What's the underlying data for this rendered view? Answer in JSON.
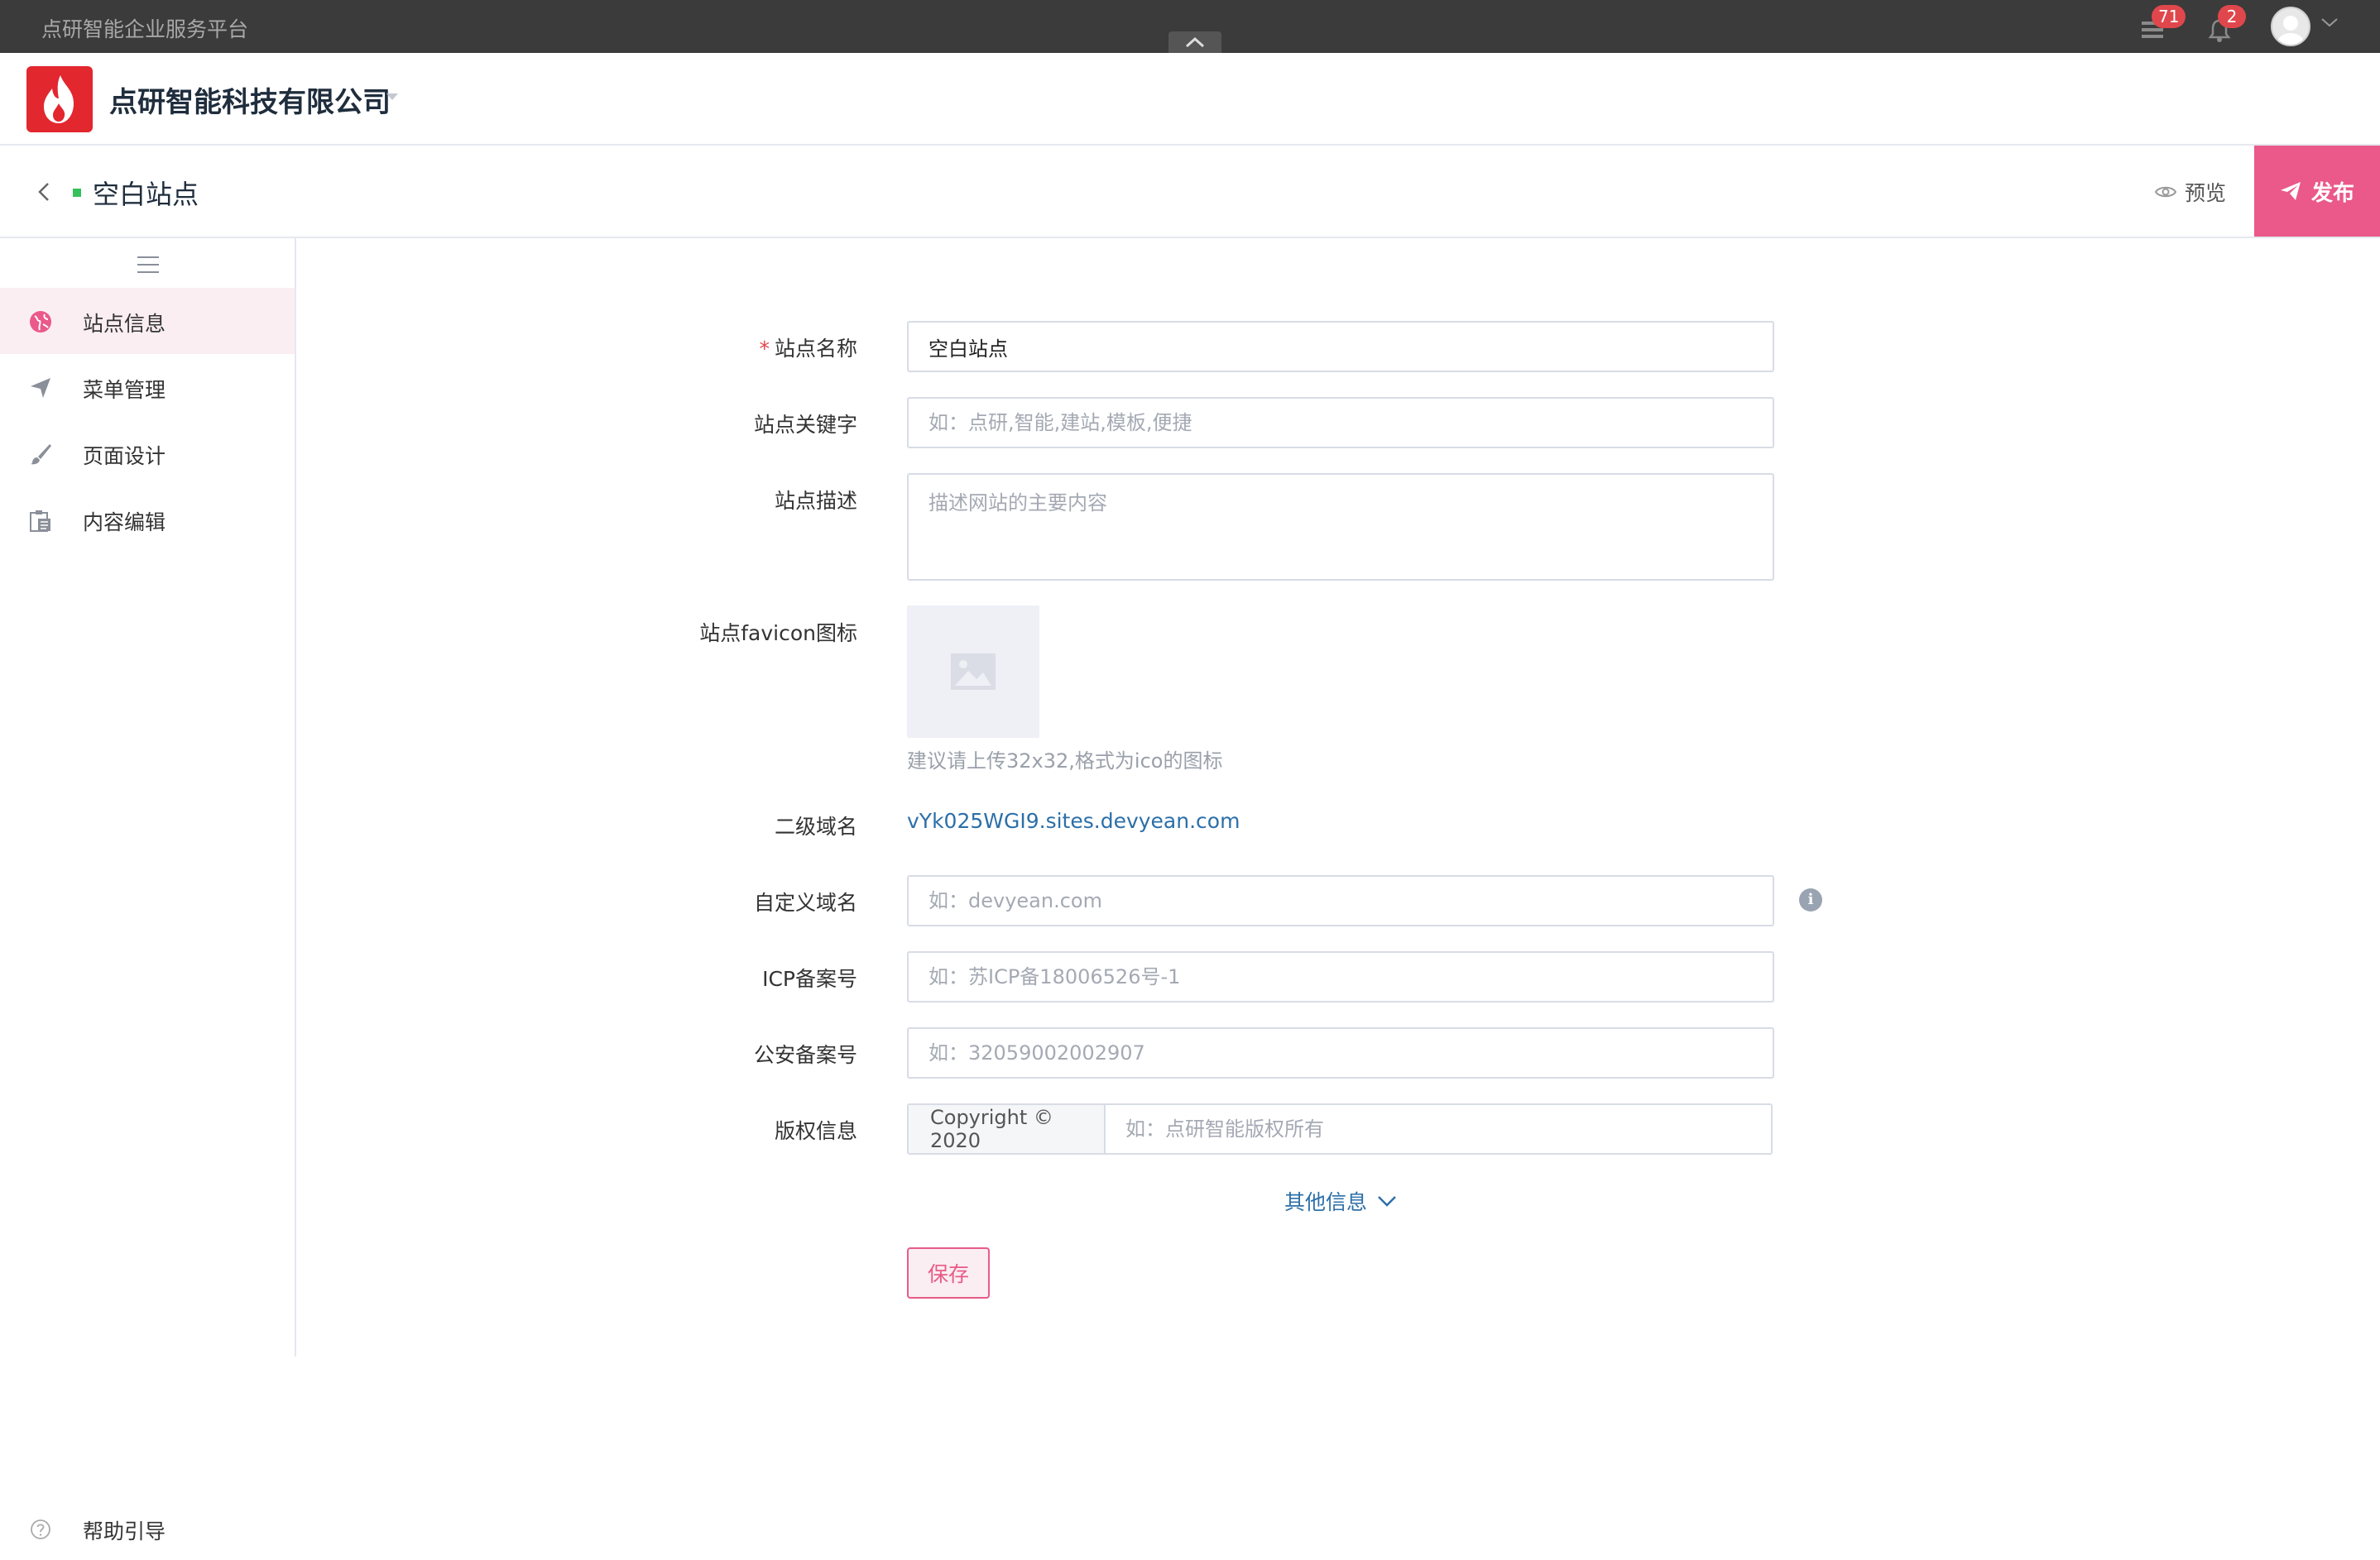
{
  "topbar": {
    "platform_name": "点研智能企业服务平台",
    "messages_badge": "71",
    "notifications_badge": "2"
  },
  "company": {
    "name": "点研智能科技有限公司"
  },
  "site_header": {
    "title": "空白站点",
    "preview_label": "预览",
    "publish_label": "发布"
  },
  "sidebar": {
    "items": [
      {
        "label": "站点信息",
        "icon": "globe-icon",
        "active": true
      },
      {
        "label": "菜单管理",
        "icon": "send-icon",
        "active": false
      },
      {
        "label": "页面设计",
        "icon": "brush-icon",
        "active": false
      },
      {
        "label": "内容编辑",
        "icon": "clipboard-icon",
        "active": false
      }
    ],
    "help_label": "帮助引导"
  },
  "form": {
    "site_name": {
      "label": "站点名称",
      "required_mark": "*",
      "value": "空白站点"
    },
    "keywords": {
      "label": "站点关键字",
      "placeholder": "如：点研,智能,建站,模板,便捷"
    },
    "description": {
      "label": "站点描述",
      "placeholder": "描述网站的主要内容"
    },
    "favicon": {
      "label": "站点favicon图标",
      "hint": "建议请上传32x32,格式为ico的图标"
    },
    "subdomain": {
      "label": "二级域名",
      "value": "vYk025WGI9.sites.devyean.com"
    },
    "custom_domain": {
      "label": "自定义域名",
      "placeholder": "如：devyean.com"
    },
    "icp": {
      "label": "ICP备案号",
      "placeholder": "如：苏ICP备18006526号-1"
    },
    "police": {
      "label": "公安备案号",
      "placeholder": "如：32059002002907"
    },
    "copyright": {
      "label": "版权信息",
      "prefix": "Copyright © 2020",
      "placeholder": "如：点研智能版权所有"
    },
    "more_info_label": "其他信息",
    "save_label": "保存"
  },
  "colors": {
    "accent": "#ea5989",
    "topbar": "#3b3b3b",
    "logo": "#e2272f",
    "link": "#2c6fa8"
  }
}
